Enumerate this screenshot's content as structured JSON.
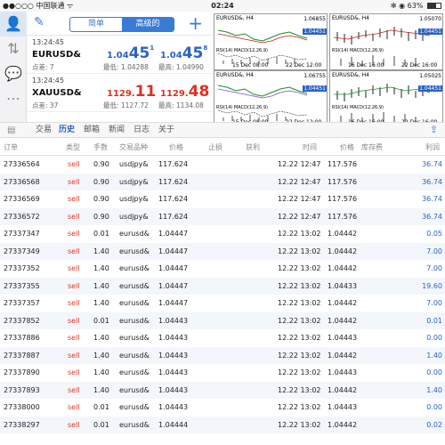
{
  "status_bar": {
    "carrier": "●●○○○ 中国联通 ᯤ",
    "time": "02:24",
    "battery": "✻ ◉ 63%",
    "battery_level": 0.63
  },
  "colors": {
    "accent": "#2a62c8",
    "sell": "#e0301e",
    "stripe": "#f3f6fb"
  },
  "sidebar": {
    "items": [
      {
        "icon": "user-icon",
        "glyph": "👤"
      },
      {
        "icon": "transfer-icon",
        "glyph": "⇅"
      },
      {
        "icon": "chat-icon",
        "glyph": "💬"
      },
      {
        "icon": "more-icon",
        "glyph": "⋯"
      }
    ]
  },
  "quotes_header": {
    "edit_icon": "✎",
    "tab_simple": "简单",
    "tab_advanced": "高级的",
    "add": "+"
  },
  "quotes": [
    {
      "time": "13:24:45",
      "symbol": "EURUSD&",
      "spread": "点差: 7",
      "bid_main": "1.04",
      "bid_big": "45",
      "bid_sup": "1",
      "low": "最低: 1.04288",
      "ask_main": "1.04",
      "ask_big": "45",
      "ask_sup": "8",
      "high": "最高: 1.04990"
    },
    {
      "time": "13:24:45",
      "symbol": "XAUUSD&",
      "spread": "点差: 37",
      "bid_main": "1129.",
      "bid_big": "11",
      "bid_sup": "",
      "low": "最低: 1127.72",
      "ask_main": "1129.",
      "ask_big": "48",
      "ask_sup": "",
      "high": "最高: 1134.08"
    }
  ],
  "charts": [
    {
      "title": "EURUSD&, H4",
      "p_high": "1.06855",
      "p_tag": "1.04451",
      "p_low": "1.04451",
      "indicator": "RSI(14) MACD(12,26,9)",
      "date1": "15 Dec 08:00",
      "date2": "22 Dec 12:00"
    },
    {
      "title": "EURUSD&, H4",
      "p_high": "1.05070",
      "p_tag": "1.04451",
      "p_low": "1.04451",
      "indicator": "RSI(14) MACD(12,26,9)",
      "date1": "16 Dec 16:00",
      "date2": "22 Dec 16:00"
    },
    {
      "title": "EURUSD&, H4",
      "p_high": "1.06755",
      "p_tag": "1.04451",
      "p_low": "1.04451",
      "indicator": "RSI(14) MACD(12,26,9)",
      "date1": "15 Dec 08:00",
      "date2": "22 Dec 12:00"
    },
    {
      "title": "EURUSD&, H4",
      "p_high": "1.05025",
      "p_tag": "1.04451",
      "p_low": "1.04451",
      "indicator": "RSI(14) MACD(12,26,9)",
      "date1": "16 Dec 16:00",
      "date2": "22 Dec 16:00"
    }
  ],
  "tabs": {
    "trade": "交易",
    "history": "历史",
    "mail": "邮箱",
    "news": "新闻",
    "journal": "日志",
    "about": "关于",
    "share_icon": "⇪"
  },
  "table_header": {
    "order": "订单",
    "type": "类型",
    "volume": "手数",
    "symbol": "交易品种",
    "price": "价格",
    "sl": "止损",
    "tp": "获利",
    "time": "时间",
    "close_price": "价格",
    "storage": "库存费",
    "profit": "利润"
  },
  "history": [
    {
      "order": "27336564",
      "type": "sell",
      "volume": "0.90",
      "symbol": "usdjpy&",
      "price": "117.624",
      "time": "12.22 12:47",
      "close": "117.576",
      "profit": "36.74"
    },
    {
      "order": "27336568",
      "type": "sell",
      "volume": "0.90",
      "symbol": "usdjpy&",
      "price": "117.624",
      "time": "12.22 12:47",
      "close": "117.576",
      "profit": "36.74"
    },
    {
      "order": "27336569",
      "type": "sell",
      "volume": "0.90",
      "symbol": "usdjpy&",
      "price": "117.624",
      "time": "12.22 12:47",
      "close": "117.576",
      "profit": "36.74"
    },
    {
      "order": "27336572",
      "type": "sell",
      "volume": "0.90",
      "symbol": "usdjpy&",
      "price": "117.624",
      "time": "12.22 12:47",
      "close": "117.576",
      "profit": "36.74"
    },
    {
      "order": "27337347",
      "type": "sell",
      "volume": "0.01",
      "symbol": "eurusd&",
      "price": "1.04447",
      "time": "12.22 13:02",
      "close": "1.04442",
      "profit": "0.05"
    },
    {
      "order": "27337349",
      "type": "sell",
      "volume": "1.40",
      "symbol": "eurusd&",
      "price": "1.04447",
      "time": "12.22 13:02",
      "close": "1.04442",
      "profit": "7.00"
    },
    {
      "order": "27337352",
      "type": "sell",
      "volume": "1.40",
      "symbol": "eurusd&",
      "price": "1.04447",
      "time": "12.22 13:02",
      "close": "1.04442",
      "profit": "7.00"
    },
    {
      "order": "27337355",
      "type": "sell",
      "volume": "1.40",
      "symbol": "eurusd&",
      "price": "1.04447",
      "time": "12.22 13:02",
      "close": "1.04433",
      "profit": "19.60"
    },
    {
      "order": "27337357",
      "type": "sell",
      "volume": "1.40",
      "symbol": "eurusd&",
      "price": "1.04447",
      "time": "12.22 13:02",
      "close": "1.04442",
      "profit": "7.00"
    },
    {
      "order": "27337852",
      "type": "sell",
      "volume": "0.01",
      "symbol": "eurusd&",
      "price": "1.04443",
      "time": "12.22 13:02",
      "close": "1.04442",
      "profit": "0.01"
    },
    {
      "order": "27337886",
      "type": "sell",
      "volume": "1.40",
      "symbol": "eurusd&",
      "price": "1.04443",
      "time": "12.22 13:02",
      "close": "1.04443",
      "profit": "0.00"
    },
    {
      "order": "27337887",
      "type": "sell",
      "volume": "1.40",
      "symbol": "eurusd&",
      "price": "1.04443",
      "time": "12.22 13:02",
      "close": "1.04442",
      "profit": "1.40"
    },
    {
      "order": "27337890",
      "type": "sell",
      "volume": "1.40",
      "symbol": "eurusd&",
      "price": "1.04443",
      "time": "12.22 13:02",
      "close": "1.04443",
      "profit": "0.00"
    },
    {
      "order": "27337893",
      "type": "sell",
      "volume": "1.40",
      "symbol": "eurusd&",
      "price": "1.04443",
      "time": "12.22 13:02",
      "close": "1.04442",
      "profit": "1.40"
    },
    {
      "order": "27338000",
      "type": "sell",
      "volume": "0.01",
      "symbol": "eurusd&",
      "price": "1.04443",
      "time": "12.22 13:02",
      "close": "1.04443",
      "profit": "0.00"
    },
    {
      "order": "27338297",
      "type": "sell",
      "volume": "0.01",
      "symbol": "eurusd&",
      "price": "1.04444",
      "time": "12.22 13:02",
      "close": "1.04442",
      "profit": "0.02"
    }
  ]
}
